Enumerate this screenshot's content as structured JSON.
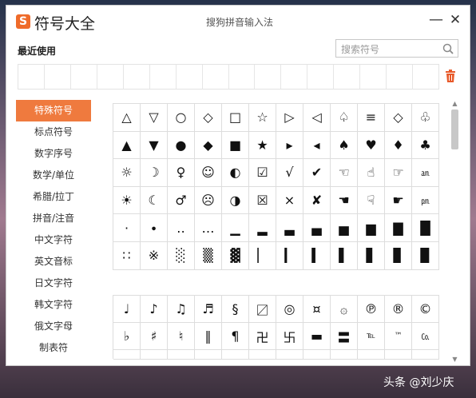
{
  "window": {
    "title": "符号大全",
    "app_name": "搜狗拼音输入法",
    "minimize_label": "—",
    "close_label": "✕"
  },
  "recent": {
    "label": "最近使用",
    "cells": 16
  },
  "search": {
    "placeholder": "搜索符号"
  },
  "sidebar": {
    "items": [
      {
        "label": "特殊符号",
        "active": true
      },
      {
        "label": "标点符号"
      },
      {
        "label": "数字序号"
      },
      {
        "label": "数学/单位"
      },
      {
        "label": "希腊/拉丁"
      },
      {
        "label": "拼音/注音"
      },
      {
        "label": "中文字符"
      },
      {
        "label": "英文音标"
      },
      {
        "label": "日文字符"
      },
      {
        "label": "韩文字符"
      },
      {
        "label": "俄文字母"
      },
      {
        "label": "制表符"
      }
    ]
  },
  "symbols_group1": [
    "△",
    "▽",
    "○",
    "◇",
    "□",
    "☆",
    "▷",
    "◁",
    "♤",
    "≡",
    "◇",
    "♧",
    "▲",
    "▼",
    "●",
    "◆",
    "■",
    "★",
    "▸",
    "◂",
    "♠",
    "♥",
    "♦",
    "♣",
    "☼",
    "☽",
    "♀",
    "☺",
    "◐",
    "☑",
    "√",
    "✔",
    "☜",
    "☝",
    "☞",
    "㏂",
    "☀",
    "☾",
    "♂",
    "☹",
    "◑",
    "☒",
    "×",
    "✘",
    "☚",
    "☟",
    "☛",
    "㏘",
    "·",
    "∙",
    "‥",
    "…",
    "▁",
    "▂",
    "▃",
    "▄",
    "▅",
    "▆",
    "▇",
    "█",
    "∷",
    "※",
    "░",
    "▒",
    "▓",
    "▏",
    "▎",
    "▍",
    "▌",
    "▋",
    "▊",
    "▉"
  ],
  "symbols_group2": [
    "♩",
    "♪",
    "♫",
    "♬",
    "§",
    "〼",
    "◎",
    "¤",
    "۞",
    "℗",
    "®",
    "©",
    "♭",
    "♯",
    "♮",
    "‖",
    "¶",
    "卍",
    "卐",
    "▬",
    "〓",
    "℡",
    "™",
    "㏇",
    "",
    "",
    "",
    "",
    "",
    "",
    "",
    "",
    "",
    "",
    "",
    ""
  ],
  "watermark": "头条 @刘少庆",
  "colors": {
    "accent": "#ef7a3e",
    "trash": "#e85a2a"
  }
}
